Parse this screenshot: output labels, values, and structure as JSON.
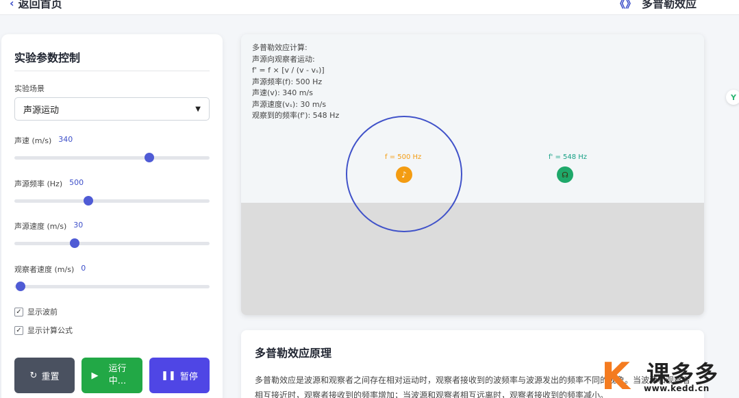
{
  "header": {
    "back_icon": "chevron-left-icon",
    "back_label": "返回首页",
    "title_icon": "sound-waves-icon",
    "title": "多普勒效应"
  },
  "panel": {
    "title": "实验参数控制",
    "scene": {
      "label": "实验场景",
      "value": "声源运动"
    },
    "sliders": [
      {
        "label": "声速 (m/s)",
        "value": "340",
        "fraction": 0.69
      },
      {
        "label": "声源频率 (Hz)",
        "value": "500",
        "fraction": 0.38
      },
      {
        "label": "声源速度 (m/s)",
        "value": "30",
        "fraction": 0.31
      },
      {
        "label": "观察者速度 (m/s)",
        "value": "0",
        "fraction": 0.03
      }
    ],
    "checkboxes": [
      {
        "label": "显示波前",
        "checked": true
      },
      {
        "label": "显示计算公式",
        "checked": true
      }
    ],
    "buttons": {
      "reset": {
        "icon": "refresh-icon",
        "label": "重置"
      },
      "run": {
        "icon": "play-icon",
        "label": "运行中..."
      },
      "pause": {
        "icon": "pause-icon",
        "label": "暂停"
      }
    }
  },
  "simulation": {
    "formula_lines": [
      "多普勒效应计算:",
      "声源向观察者运动:",
      "f' = f × [v / (v - vₛ)]",
      "声源频率(f): 500 Hz",
      "声速(v): 340 m/s",
      "声源速度(vₛ): 30 m/s",
      "观察到的频率(f'): 548 Hz"
    ],
    "source_label": "f = 500 Hz",
    "source_icon": "music-note-icon",
    "observer_label": "f' = 548 Hz",
    "observer_icon": "ear-icon"
  },
  "principle": {
    "title": "多普勒效应原理",
    "text": "多普勒效应是波源和观察者之间存在相对运动时，观察者接收到的波频率与波源发出的频率不同的现象。当波源和观察者相互接近时，观察者接收到的频率增加；当波源和观察者相互远离时，观察者接收到的频率减小。"
  },
  "watermark": {
    "name": "课多多",
    "url": "www.kedd.cn"
  },
  "colors": {
    "accent": "#4f46e5",
    "run": "#22a846",
    "reset": "#4a5160",
    "source": "#f39c12",
    "observer": "#1ea86a",
    "wave": "#4052c9"
  }
}
